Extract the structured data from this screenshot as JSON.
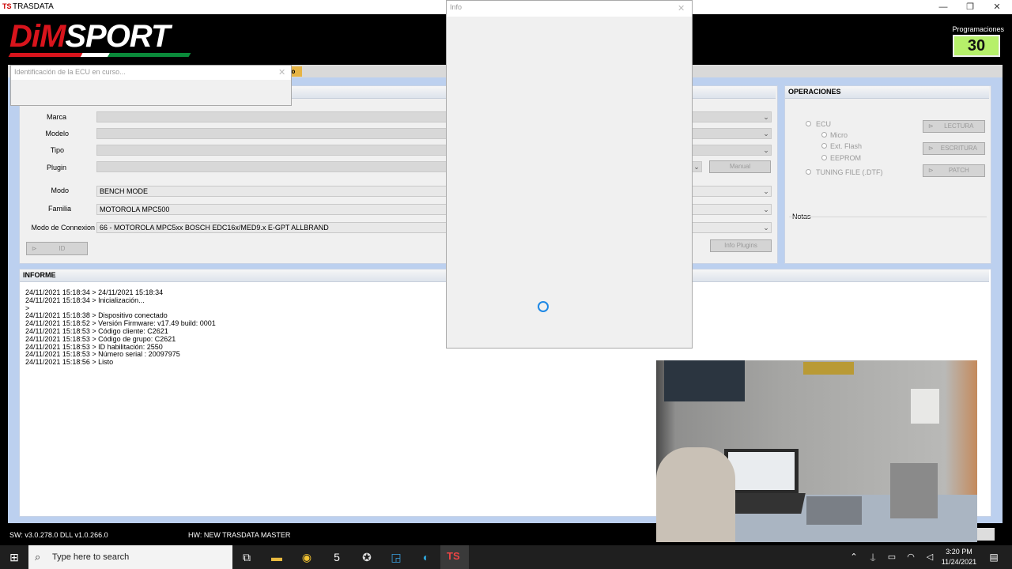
{
  "window": {
    "app_icon": "TS",
    "title": "TRASDATA",
    "minimize": "—",
    "maximize": "❐",
    "close": "✕"
  },
  "brand": {
    "logo_dim": "DiM",
    "logo_sport": "SPORT"
  },
  "programaciones": {
    "label": "Programaciones",
    "value": "30"
  },
  "popup_ecu": {
    "title": "Identificación de la ECU en curso..."
  },
  "info_dialog": {
    "title": "Info"
  },
  "form": {
    "marca_label": "Marca",
    "modelo_label": "Modelo",
    "tipo_label": "Tipo",
    "plugin_label": "Plugin",
    "manual_button": "Manual",
    "modo_label": "Modo",
    "modo_value": "BENCH MODE",
    "familia_label": "Familia",
    "familia_value": "MOTOROLA MPC500",
    "conexion_label": "Modo de Connexion",
    "conexion_value": "66 - MOTOROLA MPC5xx BOSCH EDC16x/MED9.x E-GPT ALLBRAND",
    "id_button": "ID",
    "info_plugins_button": "Info Plugins"
  },
  "operaciones": {
    "title": "OPERACIONES",
    "ecu": "ECU",
    "micro": "Micro",
    "ext_flash": "Ext. Flash",
    "eeprom": "EEPROM",
    "tuning_file": "TUNING FILE (.DTF)",
    "lectura": "LECTURA",
    "escritura": "ESCRITURA",
    "patch": "PATCH",
    "notas": "Notas"
  },
  "informe": {
    "title": "INFORME",
    "lines": [
      "24/11/2021 15:18:34 > 24/11/2021 15:18:34",
      "24/11/2021 15:18:34 > Inicialización...",
      ">",
      "24/11/2021 15:18:38 > Dispositivo conectado",
      "24/11/2021 15:18:52 > Versión Firmware: v17.49 build: 0001",
      "24/11/2021 15:18:53 > Código cliente: C2621",
      "24/11/2021 15:18:53 > Código de grupo: C2621",
      "24/11/2021 15:18:53 > ID habilitación: 2550",
      "24/11/2021 15:18:53 > Número serial : 20097975",
      "24/11/2021 15:18:56 > Listo"
    ]
  },
  "status": {
    "sw": "SW: v3.0.278.0  DLL v1.0.266.0",
    "hw": "HW: NEW TRASDATA MASTER"
  },
  "taskbar": {
    "search_placeholder": "Type here to search",
    "time": "3:20 PM",
    "date": "11/24/2021"
  }
}
